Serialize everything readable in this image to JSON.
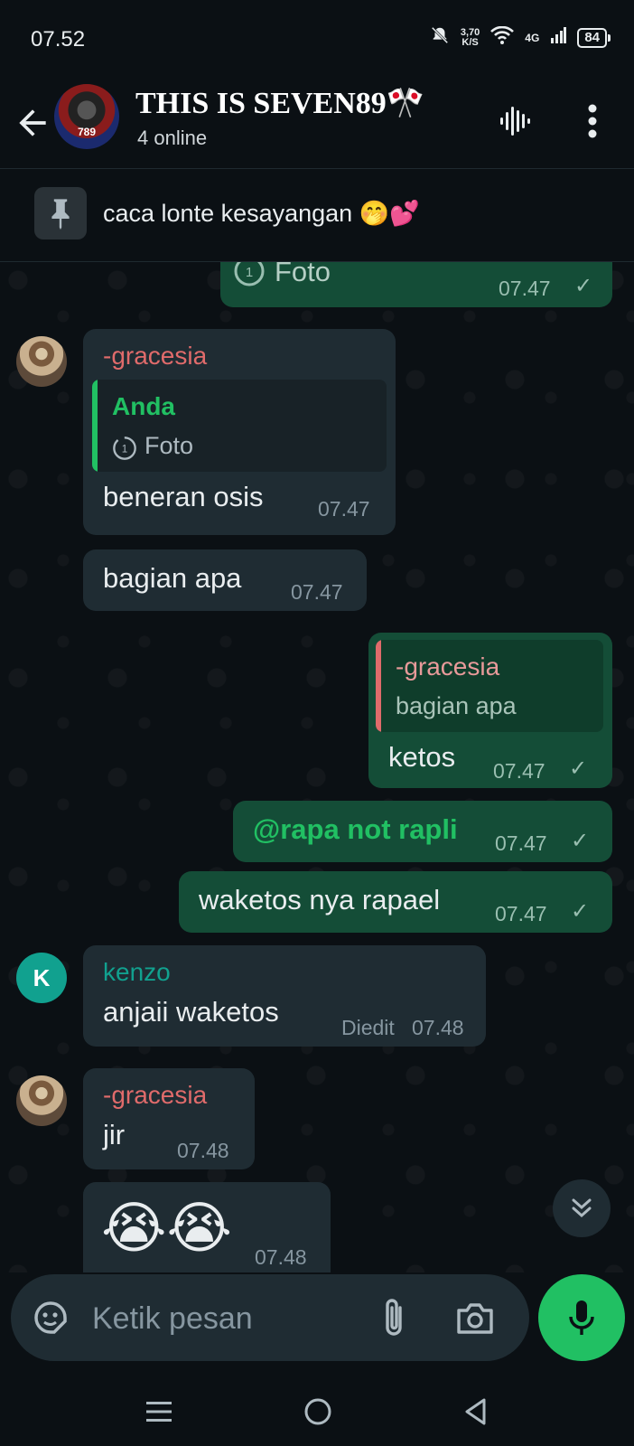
{
  "status_bar": {
    "time": "07.52",
    "net_speed_value": "3,70",
    "net_speed_unit": "K/S",
    "network": "4G",
    "battery": "84"
  },
  "header": {
    "title": "THIS IS SEVEN89🎌",
    "subtitle": "4 online",
    "avatar_text": "789"
  },
  "pinned": {
    "text": "caca lonte kesayangan 🤭💕"
  },
  "messages": [
    {
      "direction": "out",
      "content": "Foto",
      "time": "07.47"
    },
    {
      "direction": "in",
      "sender": "-gracesia",
      "reply_name": "Anda",
      "reply_text": "Foto",
      "text": "beneran osis",
      "time": "07.47"
    },
    {
      "direction": "in",
      "text": "bagian apa",
      "time": "07.47"
    },
    {
      "direction": "out",
      "reply_name": "-gracesia",
      "reply_text": "bagian apa",
      "text": "ketos",
      "time": "07.47"
    },
    {
      "direction": "out",
      "mention": "@rapa not rapli",
      "time": "07.47"
    },
    {
      "direction": "out",
      "text": "waketos nya rapael",
      "time": "07.47"
    },
    {
      "direction": "in",
      "sender": "kenzo",
      "avatar_letter": "K",
      "text": "anjaii waketos",
      "edited": "Diedit",
      "time": "07.48"
    },
    {
      "direction": "in",
      "sender": "-gracesia",
      "text": "jir",
      "time": "07.48"
    },
    {
      "direction": "in",
      "text": "😭😭",
      "time": "07.48"
    }
  ],
  "composer": {
    "placeholder": "Ketik pesan"
  },
  "colors": {
    "background": "#0b1014",
    "incoming_bubble": "#1f2c33",
    "outgoing_bubble": "#144d37",
    "accent_green": "#21c063",
    "sender_gracesia": "#e06b6b",
    "sender_kenzo": "#11a18f",
    "quote_anda": "#21c063",
    "mention": "#21c063"
  },
  "icons": {
    "back": "arrow-left-icon",
    "voice_chat": "audio-wave-icon",
    "menu": "more-vertical-icon",
    "pin": "pin-icon",
    "view_once": "view-once-icon",
    "check": "single-check-icon",
    "scroll_down": "double-chevron-down-icon",
    "sticker": "sticker-icon",
    "attach": "paperclip-icon",
    "camera": "camera-icon",
    "mic": "microphone-icon"
  }
}
